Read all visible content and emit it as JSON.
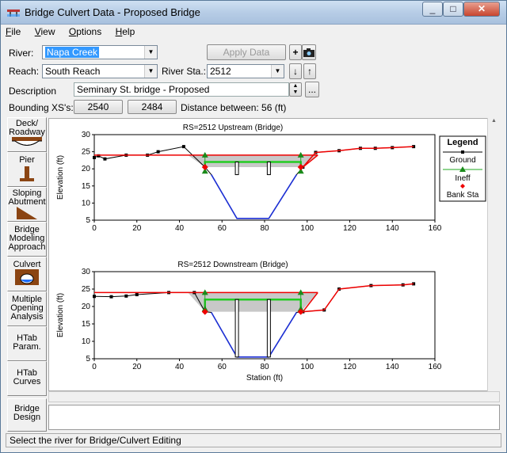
{
  "window": {
    "title": "Bridge Culvert Data - Proposed Bridge"
  },
  "menu": [
    "File",
    "View",
    "Options",
    "Help"
  ],
  "form": {
    "river_label": "River:",
    "river_value": "Napa Creek",
    "apply_label": "Apply Data",
    "reach_label": "Reach:",
    "reach_value": "South Reach",
    "river_sta_label": "River Sta.:",
    "river_sta_value": "2512",
    "description_label": "Description",
    "description_value": "Seminary St. bridge - Proposed",
    "bounding_label": "Bounding XS's:",
    "bounding_us": "2540",
    "bounding_ds": "2484",
    "distance_text": "Distance between: 56 (ft)"
  },
  "sidebar": [
    {
      "label": "Deck/ Roadway",
      "icon": "deck-roadway-icon"
    },
    {
      "label": "Pier",
      "icon": "pier-icon"
    },
    {
      "label": "Sloping Abutment",
      "icon": "abutment-icon"
    },
    {
      "label": "Bridge Modeling Approach",
      "icon": ""
    },
    {
      "label": "Culvert",
      "icon": "culvert-icon"
    },
    {
      "label": "Multiple Opening Analysis",
      "icon": ""
    },
    {
      "label": "HTab Param.",
      "icon": ""
    },
    {
      "label": "HTab Curves",
      "icon": ""
    },
    {
      "label": "Bridge Design",
      "icon": ""
    }
  ],
  "chart_data": [
    {
      "type": "line",
      "title": "RS=2512    Upstream  (Bridge)",
      "ylabel": "Elevation (ft)",
      "xlabel": "",
      "xlim": [
        0,
        160
      ],
      "ylim": [
        5,
        30
      ],
      "xticks": [
        0,
        20,
        40,
        60,
        80,
        100,
        120,
        140,
        160
      ],
      "yticks": [
        5,
        10,
        15,
        20,
        25,
        30
      ],
      "series": [
        {
          "name": "Ground",
          "color": "#000000",
          "x": [
            0,
            2,
            5,
            15,
            25,
            30,
            42,
            52,
            55,
            67,
            82,
            95,
            98,
            104,
            115,
            125,
            132,
            140,
            150
          ],
          "y": [
            23.3,
            23.8,
            22.9,
            24,
            24,
            25,
            26.5,
            20.5,
            18.3,
            5.5,
            5.5,
            18.3,
            20.5,
            24.8,
            25.3,
            26,
            26,
            26.2,
            26.5
          ]
        },
        {
          "name": "Ineff",
          "color": "#00a000",
          "x": [
            52,
            52,
            97,
            97
          ],
          "y": [
            19.3,
            24,
            24,
            19.3
          ]
        },
        {
          "name": "Bank Sta",
          "color": "#ff0000",
          "x": [
            52,
            97
          ],
          "y": [
            20.5,
            20.5
          ]
        }
      ],
      "deck_low_chord": 22,
      "deck_high_chord": 24,
      "deck_x": [
        52,
        97
      ]
    },
    {
      "type": "line",
      "title": "RS=2512    Downstream  (Bridge)",
      "ylabel": "Elevation (ft)",
      "xlabel": "Station (ft)",
      "xlim": [
        0,
        160
      ],
      "ylim": [
        5,
        30
      ],
      "xticks": [
        0,
        20,
        40,
        60,
        80,
        100,
        120,
        140,
        160
      ],
      "yticks": [
        5,
        10,
        15,
        20,
        25,
        30
      ],
      "series": [
        {
          "name": "Ground",
          "color": "#000000",
          "x": [
            0,
            8,
            15,
            20,
            35,
            47,
            52,
            55,
            67,
            82,
            95,
            98,
            108,
            115,
            130,
            145,
            150
          ],
          "y": [
            22.9,
            22.8,
            23,
            23.4,
            24,
            24,
            18.5,
            18.3,
            5.5,
            5.5,
            18.3,
            18.5,
            19,
            25,
            26,
            26.2,
            26.5
          ]
        },
        {
          "name": "Ineff",
          "color": "#00a000",
          "x": [
            52,
            52,
            97,
            97
          ],
          "y": [
            19.3,
            24,
            24,
            19.3
          ]
        },
        {
          "name": "Bank Sta",
          "color": "#ff0000",
          "x": [
            52,
            97
          ],
          "y": [
            18.5,
            18.5
          ]
        }
      ],
      "deck_low_chord": 22,
      "deck_high_chord": 24,
      "deck_x": [
        52,
        97
      ]
    }
  ],
  "legend": {
    "title": "Legend",
    "items": [
      "Ground",
      "Ineff",
      "Bank Sta"
    ]
  },
  "status": "Select the river for Bridge/Culvert Editing"
}
